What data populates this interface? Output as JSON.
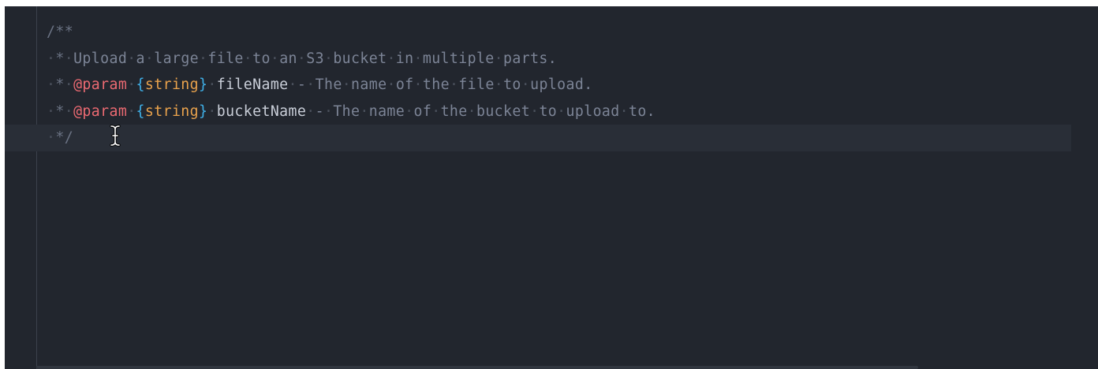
{
  "editor": {
    "lines": [
      {
        "tokens": [
          {
            "text": "/**",
            "kind": "comment"
          }
        ]
      },
      {
        "tokens": [
          {
            "text": "·",
            "kind": "ws"
          },
          {
            "text": "*",
            "kind": "comment"
          },
          {
            "text": "·",
            "kind": "ws"
          },
          {
            "text": "Upload",
            "kind": "text"
          },
          {
            "text": "·",
            "kind": "ws"
          },
          {
            "text": "a",
            "kind": "text"
          },
          {
            "text": "·",
            "kind": "ws"
          },
          {
            "text": "large",
            "kind": "text"
          },
          {
            "text": "·",
            "kind": "ws"
          },
          {
            "text": "file",
            "kind": "text"
          },
          {
            "text": "·",
            "kind": "ws"
          },
          {
            "text": "to",
            "kind": "text"
          },
          {
            "text": "·",
            "kind": "ws"
          },
          {
            "text": "an",
            "kind": "text"
          },
          {
            "text": "·",
            "kind": "ws"
          },
          {
            "text": "S3",
            "kind": "text"
          },
          {
            "text": "·",
            "kind": "ws"
          },
          {
            "text": "bucket",
            "kind": "text"
          },
          {
            "text": "·",
            "kind": "ws"
          },
          {
            "text": "in",
            "kind": "text"
          },
          {
            "text": "·",
            "kind": "ws"
          },
          {
            "text": "multiple",
            "kind": "text"
          },
          {
            "text": "·",
            "kind": "ws"
          },
          {
            "text": "parts.",
            "kind": "text"
          }
        ]
      },
      {
        "tokens": [
          {
            "text": "·",
            "kind": "ws"
          },
          {
            "text": "*",
            "kind": "comment"
          },
          {
            "text": "·",
            "kind": "ws"
          },
          {
            "text": "@param",
            "kind": "tag"
          },
          {
            "text": "·",
            "kind": "ws"
          },
          {
            "text": "{",
            "kind": "brace"
          },
          {
            "text": "string",
            "kind": "type"
          },
          {
            "text": "}",
            "kind": "brace"
          },
          {
            "text": "·",
            "kind": "ws"
          },
          {
            "text": "fileName",
            "kind": "param"
          },
          {
            "text": "·",
            "kind": "ws"
          },
          {
            "text": "-",
            "kind": "text"
          },
          {
            "text": "·",
            "kind": "ws"
          },
          {
            "text": "The",
            "kind": "text"
          },
          {
            "text": "·",
            "kind": "ws"
          },
          {
            "text": "name",
            "kind": "text"
          },
          {
            "text": "·",
            "kind": "ws"
          },
          {
            "text": "of",
            "kind": "text"
          },
          {
            "text": "·",
            "kind": "ws"
          },
          {
            "text": "the",
            "kind": "text"
          },
          {
            "text": "·",
            "kind": "ws"
          },
          {
            "text": "file",
            "kind": "text"
          },
          {
            "text": "·",
            "kind": "ws"
          },
          {
            "text": "to",
            "kind": "text"
          },
          {
            "text": "·",
            "kind": "ws"
          },
          {
            "text": "upload.",
            "kind": "text"
          }
        ]
      },
      {
        "tokens": [
          {
            "text": "·",
            "kind": "ws"
          },
          {
            "text": "*",
            "kind": "comment"
          },
          {
            "text": "·",
            "kind": "ws"
          },
          {
            "text": "@param",
            "kind": "tag"
          },
          {
            "text": "·",
            "kind": "ws"
          },
          {
            "text": "{",
            "kind": "brace"
          },
          {
            "text": "string",
            "kind": "type"
          },
          {
            "text": "}",
            "kind": "brace"
          },
          {
            "text": "·",
            "kind": "ws"
          },
          {
            "text": "bucketName",
            "kind": "param"
          },
          {
            "text": "·",
            "kind": "ws"
          },
          {
            "text": "-",
            "kind": "text"
          },
          {
            "text": "·",
            "kind": "ws"
          },
          {
            "text": "The",
            "kind": "text"
          },
          {
            "text": "·",
            "kind": "ws"
          },
          {
            "text": "name",
            "kind": "text"
          },
          {
            "text": "·",
            "kind": "ws"
          },
          {
            "text": "of",
            "kind": "text"
          },
          {
            "text": "·",
            "kind": "ws"
          },
          {
            "text": "the",
            "kind": "text"
          },
          {
            "text": "·",
            "kind": "ws"
          },
          {
            "text": "bucket",
            "kind": "text"
          },
          {
            "text": "·",
            "kind": "ws"
          },
          {
            "text": "to",
            "kind": "text"
          },
          {
            "text": "·",
            "kind": "ws"
          },
          {
            "text": "upload",
            "kind": "text"
          },
          {
            "text": "·",
            "kind": "ws"
          },
          {
            "text": "to.",
            "kind": "text"
          }
        ]
      },
      {
        "current": true,
        "tokens": [
          {
            "text": "·",
            "kind": "ws"
          },
          {
            "text": "*/",
            "kind": "comment"
          }
        ]
      }
    ],
    "mouse_cursor_icon": "i-beam-cursor-icon"
  },
  "colors": {
    "background": "#22262e",
    "current_line": "#292e37",
    "comment": "#6b7384",
    "doc_text": "#7c8496",
    "jsdoc_tag": "#ec6a72",
    "type": "#e9a24c",
    "brace": "#3fb0e8",
    "param_name": "#c9ced8"
  }
}
